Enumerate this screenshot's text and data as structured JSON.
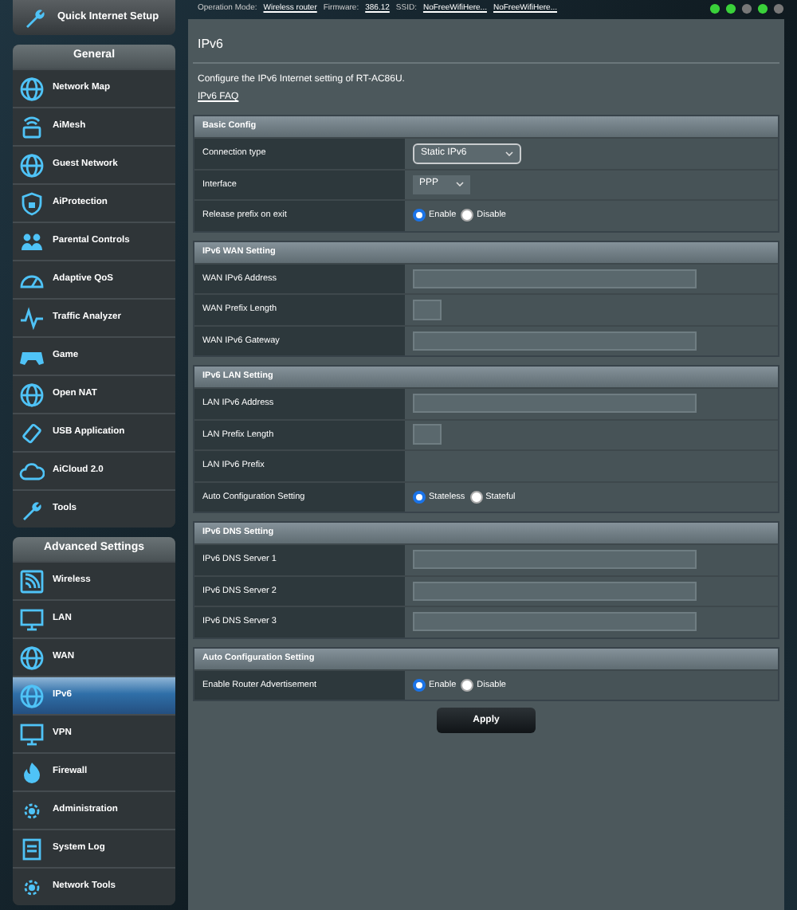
{
  "top_bar": {
    "items": [
      {
        "label": "Operation Mode:",
        "value": "Wireless router"
      },
      {
        "label": "Firmware:",
        "value": "386.12"
      },
      {
        "label": "SSID:",
        "value": "NoFreeWifiHere..."
      },
      {
        "value": "NoFreeWifiHere..."
      }
    ]
  },
  "sidebar": {
    "quick_setup": "Quick Internet Setup",
    "sections": [
      {
        "title": "General",
        "items": [
          {
            "label": "Network Map",
            "selected": false
          },
          {
            "label": "AiMesh",
            "selected": false
          },
          {
            "label": "Guest Network",
            "selected": false
          },
          {
            "label": "AiProtection",
            "selected": false
          },
          {
            "label": "Parental Controls",
            "selected": false
          },
          {
            "label": "Adaptive QoS",
            "selected": false
          },
          {
            "label": "Traffic Analyzer",
            "selected": false
          },
          {
            "label": "Game",
            "selected": false
          },
          {
            "label": "Open NAT",
            "selected": false
          },
          {
            "label": "USB Application",
            "selected": false
          },
          {
            "label": "AiCloud 2.0",
            "selected": false
          },
          {
            "label": "Tools",
            "selected": false
          }
        ]
      },
      {
        "title": "Advanced Settings",
        "items": [
          {
            "label": "Wireless",
            "selected": false
          },
          {
            "label": "LAN",
            "selected": false
          },
          {
            "label": "WAN",
            "selected": false
          },
          {
            "label": "IPv6",
            "selected": true
          },
          {
            "label": "VPN",
            "selected": false
          },
          {
            "label": "Firewall",
            "selected": false
          },
          {
            "label": "Administration",
            "selected": false
          },
          {
            "label": "System Log",
            "selected": false
          },
          {
            "label": "Network Tools",
            "selected": false
          }
        ]
      }
    ]
  },
  "main": {
    "title": "IPv6",
    "description": "Configure the IPv6 Internet setting of RT-AC86U.",
    "faq_link": "IPv6 FAQ",
    "sections": [
      {
        "title": "Basic Config",
        "rows": [
          {
            "label": "Connection type",
            "kind": "select",
            "value": "Static IPv6"
          },
          {
            "label": "Interface",
            "kind": "smallselect",
            "value": "PPP"
          },
          {
            "label": "Release prefix on exit",
            "kind": "radio",
            "options": [
              {
                "label": "Enable",
                "selected": true
              },
              {
                "label": "Disable",
                "selected": false
              }
            ]
          }
        ]
      },
      {
        "title": "IPv6 WAN Setting",
        "rows": [
          {
            "label": "WAN IPv6 Address",
            "kind": "text"
          },
          {
            "label": "WAN Prefix Length",
            "kind": "short"
          },
          {
            "label": "WAN IPv6 Gateway",
            "kind": "text"
          }
        ]
      },
      {
        "title": "IPv6 LAN Setting",
        "rows": [
          {
            "label": "LAN IPv6 Address",
            "kind": "text"
          },
          {
            "label": "LAN Prefix Length",
            "kind": "short"
          },
          {
            "label": "LAN IPv6 Prefix",
            "kind": "empty"
          },
          {
            "label": "Auto Configuration Setting",
            "kind": "radio",
            "options": [
              {
                "label": "Stateless",
                "selected": true
              },
              {
                "label": "Stateful",
                "selected": false
              }
            ]
          }
        ]
      },
      {
        "title": "IPv6 DNS Setting",
        "rows": [
          {
            "label": "IPv6 DNS Server 1",
            "kind": "text"
          },
          {
            "label": "IPv6 DNS Server 2",
            "kind": "text"
          },
          {
            "label": "IPv6 DNS Server 3",
            "kind": "text"
          }
        ]
      },
      {
        "title": "Auto Configuration Setting",
        "rows": [
          {
            "label": "Enable Router Advertisement",
            "kind": "radio",
            "options": [
              {
                "label": "Enable",
                "selected": true
              },
              {
                "label": "Disable",
                "selected": false
              }
            ]
          }
        ]
      }
    ],
    "apply_button": "Apply"
  }
}
